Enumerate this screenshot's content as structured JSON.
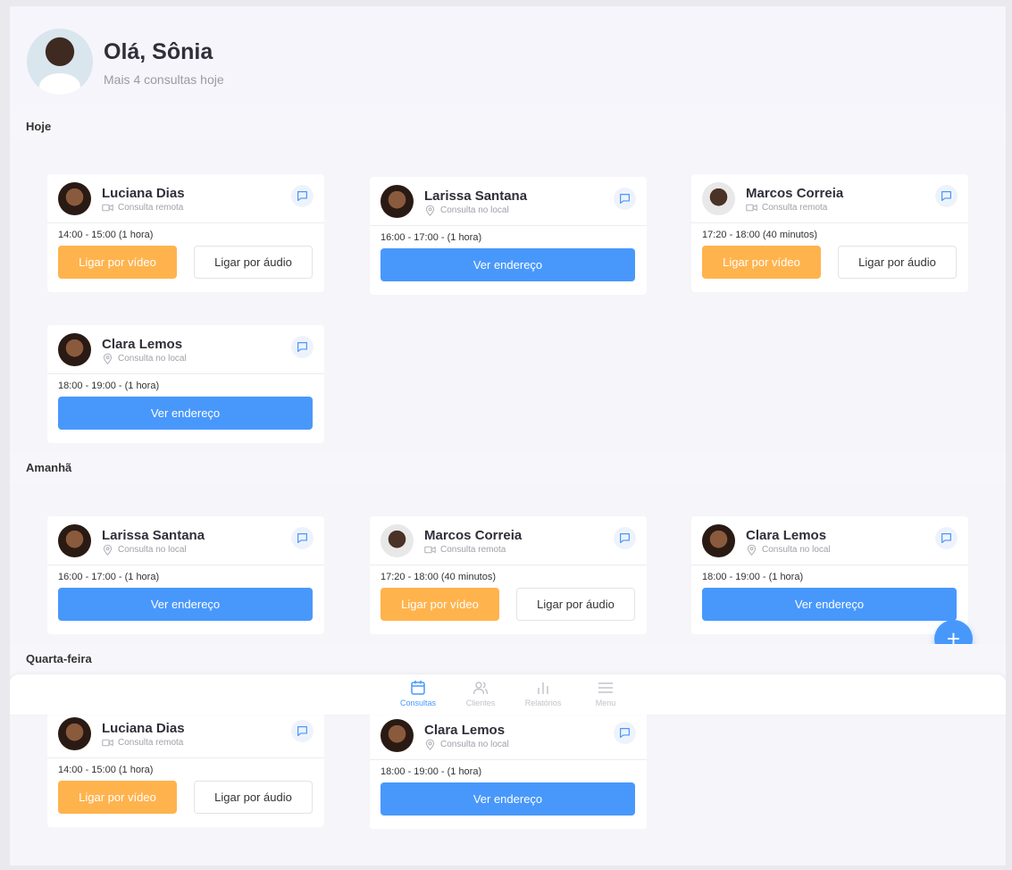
{
  "header": {
    "greeting": "Olá, Sônia",
    "subtitle": "Mais 4 consultas hoje"
  },
  "sections": [
    {
      "label": "Hoje",
      "cards": [
        {
          "name": "Luciana Dias",
          "type": "Consulta remota",
          "time": "14:00 - 15:00 (1 hora)",
          "video": "Ligar por vídeo",
          "audio": "Ligar por áudio"
        },
        {
          "name": "Larissa Santana",
          "type": "Consulta no local",
          "time": "16:00 - 17:00 - (1 hora)",
          "address": "Ver endereço"
        },
        {
          "name": "Marcos Correia",
          "type": "Consulta remota",
          "time": "17:20 - 18:00 (40 minutos)",
          "video": "Ligar por vídeo",
          "audio": "Ligar por áudio"
        },
        {
          "name": "Clara Lemos",
          "type": "Consulta no local",
          "time": "18:00 - 19:00 - (1 hora)",
          "address": "Ver endereço"
        }
      ]
    },
    {
      "label": "Amanhã",
      "cards": [
        {
          "name": "Larissa Santana",
          "type": "Consulta no local",
          "time": "16:00 - 17:00 - (1 hora)",
          "address": "Ver endereço"
        },
        {
          "name": "Marcos Correia",
          "type": "Consulta remota",
          "time": "17:20 - 18:00 (40 minutos)",
          "video": "Ligar por vídeo",
          "audio": "Ligar por áudio"
        },
        {
          "name": "Clara Lemos",
          "type": "Consulta no local",
          "time": "18:00 - 19:00 - (1 hora)",
          "address": "Ver endereço"
        }
      ]
    },
    {
      "label": "Quarta-feira",
      "cards": [
        {
          "name": "Luciana Dias",
          "type": "Consulta remota",
          "time": "14:00 - 15:00 (1 hora)",
          "video": "Ligar por vídeo",
          "audio": "Ligar por áudio"
        },
        {
          "name": "Clara Lemos",
          "type": "Consulta no local",
          "time": "18:00 - 19:00 - (1 hora)",
          "address": "Ver endereço"
        }
      ]
    }
  ],
  "fab": "+",
  "nav": [
    {
      "label": "Consultas",
      "icon": "calendar-icon",
      "active": true
    },
    {
      "label": "Clientes",
      "icon": "users-icon",
      "active": false
    },
    {
      "label": "Relatórios",
      "icon": "bar-chart-icon",
      "active": false
    },
    {
      "label": "Menu",
      "icon": "menu-icon",
      "active": false
    }
  ],
  "colors": {
    "accent": "#4898fc",
    "video": "#ffb34d"
  }
}
